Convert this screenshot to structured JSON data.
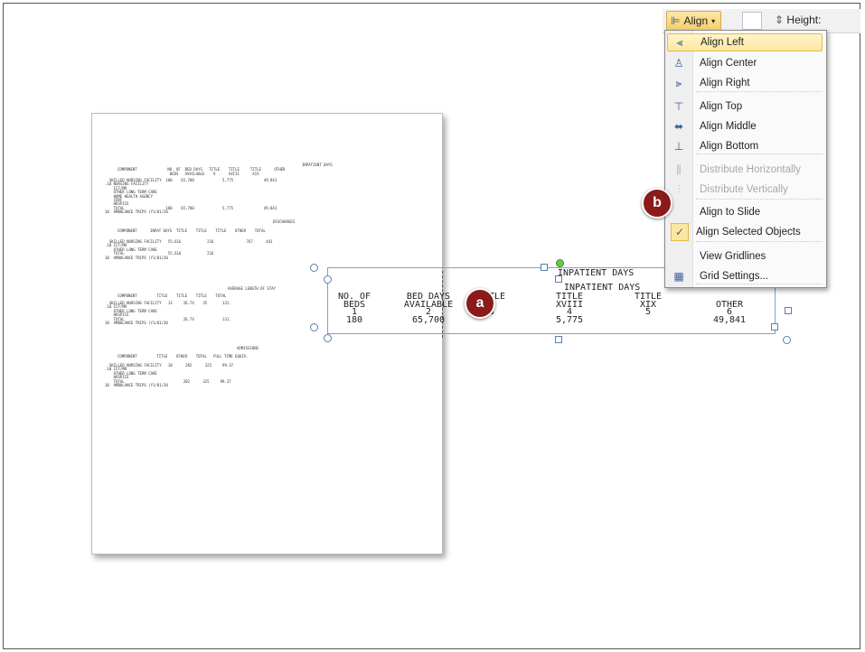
{
  "ribbon": {
    "align_label": "Align",
    "align_icon": "align-icon",
    "dropdown_icon": "chevron-down-icon",
    "height_label": "Height:"
  },
  "menu": {
    "items": [
      {
        "label": "Align Left",
        "icon": "align-left-icon",
        "highlighted": true,
        "disabled": false
      },
      {
        "label": "Align Center",
        "icon": "align-center-icon",
        "highlighted": false,
        "disabled": false
      },
      {
        "label": "Align Right",
        "icon": "align-right-icon",
        "highlighted": false,
        "disabled": false
      },
      {
        "label": "Align Top",
        "icon": "align-top-icon",
        "highlighted": false,
        "disabled": false
      },
      {
        "label": "Align Middle",
        "icon": "align-middle-icon",
        "highlighted": false,
        "disabled": false
      },
      {
        "label": "Align Bottom",
        "icon": "align-bottom-icon",
        "highlighted": false,
        "disabled": false
      },
      {
        "label": "Distribute Horizontally",
        "icon": "distribute-horizontal-icon",
        "highlighted": false,
        "disabled": true
      },
      {
        "label": "Distribute Vertically",
        "icon": "distribute-vertical-icon",
        "highlighted": false,
        "disabled": true
      },
      {
        "label": "Align to Slide",
        "icon": "",
        "highlighted": false,
        "disabled": false
      },
      {
        "label": "Align Selected Objects",
        "icon": "check-icon",
        "highlighted": false,
        "disabled": false,
        "checked": true
      },
      {
        "label": "View Gridlines",
        "icon": "",
        "highlighted": false,
        "disabled": false
      },
      {
        "label": "Grid Settings...",
        "icon": "grid-icon",
        "highlighted": false,
        "disabled": false
      }
    ]
  },
  "callouts": {
    "a": "a",
    "b": "b"
  },
  "zoom_table": {
    "top_header": "INPATIENT DAYS",
    "group_header": "INPATIENT DAYS",
    "columns": [
      {
        "h1": "NO. OF",
        "h2": "BEDS",
        "n": "1",
        "v": "180"
      },
      {
        "h1": "BED DAYS",
        "h2": "AVAILABLE",
        "n": "2",
        "v": "65,700"
      },
      {
        "h1": "TITLE",
        "h2": "V",
        "n": "3",
        "v": ""
      },
      {
        "h1": "TITLE",
        "h2": "XVIII",
        "n": "4",
        "v": "5,775"
      },
      {
        "h1": "TITLE",
        "h2": "XIX",
        "n": "5",
        "v": ""
      },
      {
        "h1": "",
        "h2": "OTHER",
        "n": "6",
        "v": "49,841"
      }
    ]
  },
  "document": {
    "s1_title": "INPATIENT DAYS",
    "s1_header": "COMPONENT              NO. OF  BED DAYS   TITLE    TITLE     TITLE      OTHER",
    "s1_header2": "                        BEDS   AVAILABLE    V      XVIII      XIX",
    "s1_rows": [
      "  SKILLED NURSING FACILITY  180    65,700             5,775              49,841",
      ".10 NURSING FACILITY",
      "    ICF/MR",
      "    OTHER LONG TERM CARE",
      "    HOME HEALTH AGENCY",
      "    CORF",
      "    HOSPICE",
      "    TOTAL                   180    65,700             5,775              49,841",
      "10  AMBULANCE TRIPS (Y1/01/20"
    ],
    "s2_title": "DISCHARGES",
    "s2_header": "COMPONENT      INPAT DAYS  TITLE    TITLE    TITLE    OTHER    TOTAL",
    "s2_rows": [
      "  SKILLED NURSING FACILITY   55,616            216               767      441",
      ".10 ICF/MR",
      "    OTHER LONG TERM CARE",
      "    TOTAL                    55,616            216",
      "10  AMBULANCE TRIPS (Y1/01/20"
    ],
    "s3_title": "AVERAGE LENGTH OF STAY",
    "s3_header": "COMPONENT         TITLE    TITLE    TITLE    TOTAL",
    "s3_rows": [
      "  SKILLED NURSING FACILITY   13     26.74    35       131.",
      ".10 ICF/MR",
      "    OTHER LONG TERM CARE",
      "    HOSPICE",
      "    TOTAL                           26.74             131.",
      "10  AMBULANCE TRIPS (Y1/01/20"
    ],
    "s4_title": "ADMISSIONS",
    "s4_header": "COMPONENT         TITLE    OTHER    TOTAL   FULL TIME EQUIV.",
    "s4_rows": [
      "  SKILLED NURSING FACILITY   10      282      325     99.37",
      ".10 ICF/MR",
      "    OTHER LONG TERM CARE",
      "    HOSPICE",
      "    TOTAL                           282      325     99.37",
      "10  AMBULANCE TRIPS (Y1/01/20"
    ]
  }
}
